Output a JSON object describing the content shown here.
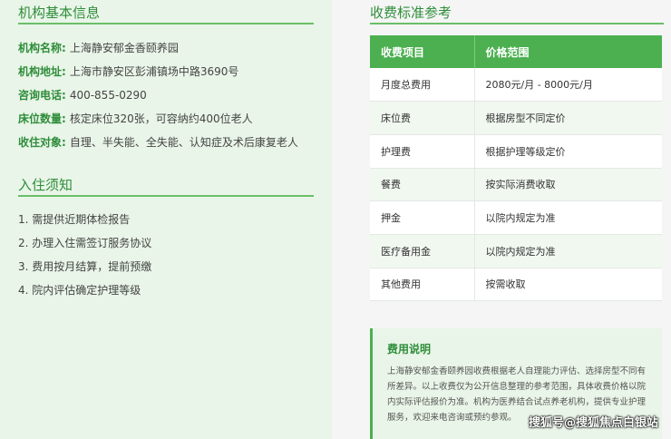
{
  "basic_info": {
    "title": "机构基本信息",
    "rows": [
      {
        "key": "机构名称:",
        "value": "上海静安郁金香颐养园"
      },
      {
        "key": "机构地址:",
        "value": "上海市静安区彭浦镇场中路3690号"
      },
      {
        "key": "咨询电话:",
        "value": "400-855-0290"
      },
      {
        "key": "床位数量:",
        "value": "核定床位320张，可容纳约400位老人"
      },
      {
        "key": "收住对象:",
        "value": "自理、半失能、全失能、认知症及术后康复老人"
      }
    ]
  },
  "notice": {
    "title": "入住须知",
    "items": [
      "1. 需提供近期体检报告",
      "2. 办理入住需签订服务协议",
      "3. 费用按月结算，提前预缴",
      "4. 院内评估确定护理等级"
    ]
  },
  "fees": {
    "title": "收费标准参考",
    "headers": [
      "收费项目",
      "价格范围"
    ],
    "rows": [
      [
        "月度总费用",
        "2080元/月 - 8000元/月"
      ],
      [
        "床位费",
        "根据房型不同定价"
      ],
      [
        "护理费",
        "根据护理等级定价"
      ],
      [
        "餐费",
        "按实际消费收取"
      ],
      [
        "押金",
        "以院内规定为准"
      ],
      [
        "医疗备用金",
        "以院内规定为准"
      ],
      [
        "其他费用",
        "按需收取"
      ]
    ]
  },
  "fee_note": {
    "title": "费用说明",
    "text": "上海静安郁金香颐养园收费根据老人自理能力评估、选择房型不同有所差异。以上收费仅为公开信息整理的参考范围，具体收费价格以院内实际评估报价为准。机构为医养结合试点养老机构，提供专业护理服务，欢迎来电咨询或预约参观。"
  },
  "watermark": "搜狐号@搜狐焦点白银站",
  "colors": {
    "accent": "#4caf50",
    "title_green": "#2f8d3b",
    "panel_bg": "#e9f5e8"
  }
}
